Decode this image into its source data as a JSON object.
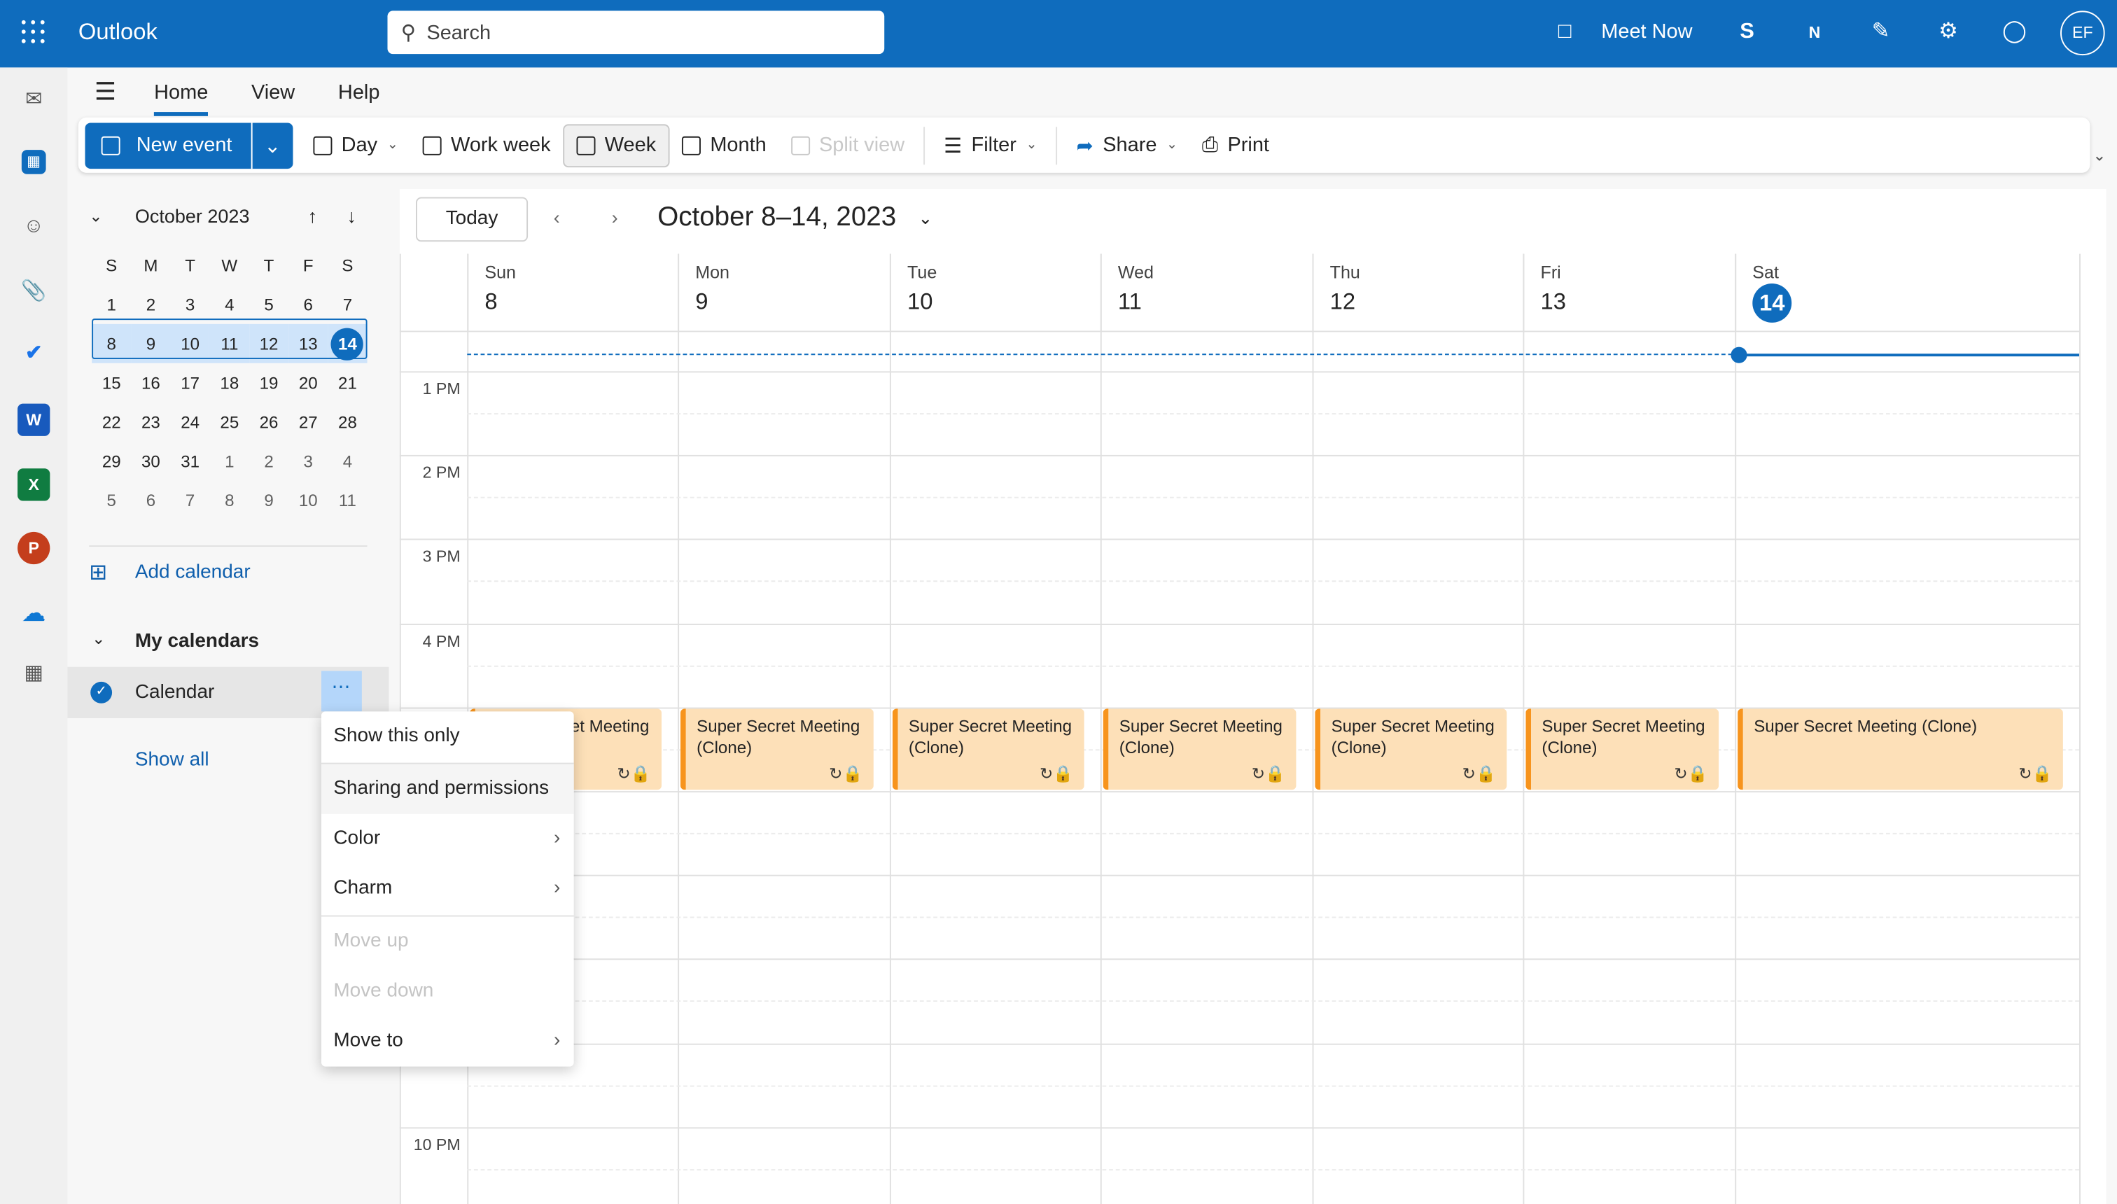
{
  "header": {
    "app_name": "Outlook",
    "search_placeholder": "Search",
    "meet_now": "Meet Now",
    "avatar_initials": "EF",
    "brand_color": "#0f6cbd"
  },
  "tabs": [
    "Home",
    "View",
    "Help"
  ],
  "ribbon": {
    "new_event": "New event",
    "day": "Day",
    "work_week": "Work week",
    "week": "Week",
    "month": "Month",
    "split_view": "Split view",
    "filter": "Filter",
    "share": "Share",
    "print": "Print"
  },
  "mini_calendar": {
    "title": "October 2023",
    "weekdays": [
      "S",
      "M",
      "T",
      "W",
      "T",
      "F",
      "S"
    ],
    "weeks": [
      [
        "1",
        "2",
        "3",
        "4",
        "5",
        "6",
        "7"
      ],
      [
        "8",
        "9",
        "10",
        "11",
        "12",
        "13",
        "14"
      ],
      [
        "15",
        "16",
        "17",
        "18",
        "19",
        "20",
        "21"
      ],
      [
        "22",
        "23",
        "24",
        "25",
        "26",
        "27",
        "28"
      ],
      [
        "29",
        "30",
        "31",
        "1",
        "2",
        "3",
        "4"
      ],
      [
        "5",
        "6",
        "7",
        "8",
        "9",
        "10",
        "11"
      ]
    ],
    "today": "14"
  },
  "sidebar": {
    "add_calendar": "Add calendar",
    "my_calendars": "My calendars",
    "calendar": "Calendar",
    "show_all": "Show all"
  },
  "context_menu": [
    "Show this only",
    "Sharing and permissions",
    "Color",
    "Charm",
    "Move up",
    "Move down",
    "Move to"
  ],
  "calendar": {
    "today": "Today",
    "range": "October 8–14, 2023",
    "days": [
      {
        "name": "Sun",
        "date": "8"
      },
      {
        "name": "Mon",
        "date": "9"
      },
      {
        "name": "Tue",
        "date": "10"
      },
      {
        "name": "Wed",
        "date": "11"
      },
      {
        "name": "Thu",
        "date": "12"
      },
      {
        "name": "Fri",
        "date": "13"
      },
      {
        "name": "Sat",
        "date": "14"
      }
    ],
    "time_labels": [
      "1 PM",
      "2 PM",
      "3 PM",
      "4 PM",
      "10 PM"
    ],
    "events": [
      "Super Secret Meeting",
      "Super Secret Meeting (Clone)",
      "Super Secret Meeting (Clone)",
      "Super Secret Meeting (Clone)",
      "Super Secret Meeting (Clone)",
      "Super Secret Meeting (Clone)",
      "Super Secret Meeting (Clone)"
    ],
    "event_color": "#f7941d"
  }
}
